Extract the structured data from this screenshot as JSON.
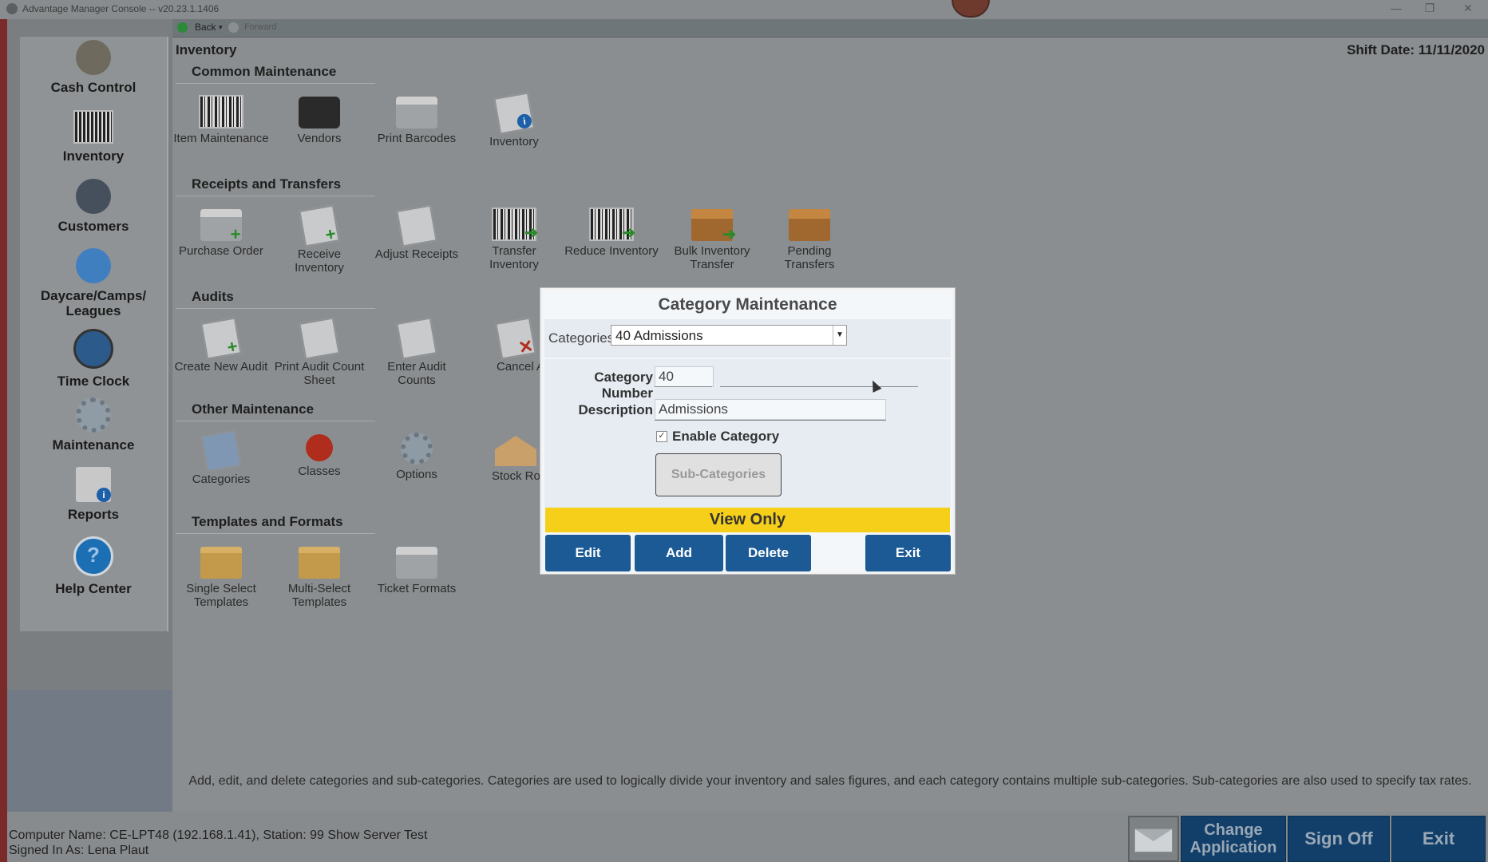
{
  "window": {
    "title": "Advantage Manager Console -- v20.23.1.1406",
    "controls": [
      "—",
      "❐",
      "✕"
    ]
  },
  "nav": {
    "back": "Back",
    "forward": "Forward"
  },
  "sidebar": {
    "items": [
      {
        "label": "Cash Control",
        "icon": "money-bag-icon"
      },
      {
        "label": "Inventory",
        "icon": "barcode-icon"
      },
      {
        "label": "Customers",
        "icon": "person-icon"
      },
      {
        "label": "Daycare/Camps/ Leagues",
        "icon": "child-icon"
      },
      {
        "label": "Time Clock",
        "icon": "clock-icon"
      },
      {
        "label": "Maintenance",
        "icon": "gear-icon"
      },
      {
        "label": "Reports",
        "icon": "report-icon"
      },
      {
        "label": "Help Center",
        "icon": "help-icon"
      }
    ]
  },
  "main": {
    "breadcrumb": "Inventory",
    "shift_date": "Shift Date: 11/11/2020",
    "sections": [
      {
        "title": "Common Maintenance",
        "tiles": [
          {
            "label": "Item Maintenance",
            "icon": "barcode-icon"
          },
          {
            "label": "Vendors",
            "icon": "briefcase-icon"
          },
          {
            "label": "Print Barcodes",
            "icon": "printer-icon"
          },
          {
            "label": "Inventory",
            "icon": "inventory-report-icon"
          }
        ]
      },
      {
        "title": "Receipts and Transfers",
        "tiles": [
          {
            "label": "Purchase Order",
            "icon": "purchase-order-icon"
          },
          {
            "label": "Receive Inventory",
            "icon": "receive-icon"
          },
          {
            "label": "Adjust Receipts",
            "icon": "adjust-icon"
          },
          {
            "label": "Transfer Inventory",
            "icon": "transfer-icon"
          },
          {
            "label": "Reduce Inventory",
            "icon": "reduce-icon"
          },
          {
            "label": "Bulk Inventory Transfer",
            "icon": "box-icon"
          },
          {
            "label": "Pending Transfers",
            "icon": "box-icon"
          }
        ]
      },
      {
        "title": "Audits",
        "tiles": [
          {
            "label": "Create New Audit",
            "icon": "audit-new-icon"
          },
          {
            "label": "Print Audit Count Sheet",
            "icon": "audit-print-icon"
          },
          {
            "label": "Enter Audit Counts",
            "icon": "audit-enter-icon"
          },
          {
            "label": "Cancel Aud",
            "icon": "audit-cancel-icon"
          }
        ]
      },
      {
        "title": "Other Maintenance",
        "tiles": [
          {
            "label": "Categories",
            "icon": "notebook-icon"
          },
          {
            "label": "Classes",
            "icon": "pushpin-icon"
          },
          {
            "label": "Options",
            "icon": "options-gear-icon"
          },
          {
            "label": "Stock Roon",
            "icon": "house-icon"
          }
        ]
      },
      {
        "title": "Templates and Formats",
        "tiles": [
          {
            "label": "Single Select Templates",
            "icon": "folder-icon"
          },
          {
            "label": "Multi-Select Templates",
            "icon": "folder-icon"
          },
          {
            "label": "Ticket Formats",
            "icon": "ticket-printer-icon"
          }
        ]
      }
    ]
  },
  "description": "Add, edit, and delete categories and sub-categories.  Categories are used to logically divide your inventory and sales figures, and each category contains multiple sub-categories.  Sub-categories are also used to specify tax rates.",
  "status": {
    "computer": "Computer Name: CE-LPT48 (192.168.1.41), Station: 99 Show Server Test",
    "signed_in": "Signed In As: Lena Plaut"
  },
  "bottom_buttons": {
    "change_application": "Change Application",
    "sign_off": "Sign Off",
    "exit": "Exit"
  },
  "modal": {
    "title": "Category Maintenance",
    "categories_label": "Categories",
    "categories_value": "40 Admissions",
    "category_number_label": "Category Number",
    "category_number_value": "40",
    "description_label": "Description",
    "description_value": "Admissions",
    "enable_label": "Enable Category",
    "enable_checked": true,
    "subcategories_button": "Sub-Categories",
    "view_only": "View Only",
    "buttons": {
      "edit": "Edit",
      "add": "Add",
      "delete": "Delete",
      "exit": "Exit"
    }
  },
  "colors": {
    "accent_blue": "#1b5a94",
    "view_only_yellow": "#f5cf19",
    "bottom_button": "#123f6a"
  }
}
